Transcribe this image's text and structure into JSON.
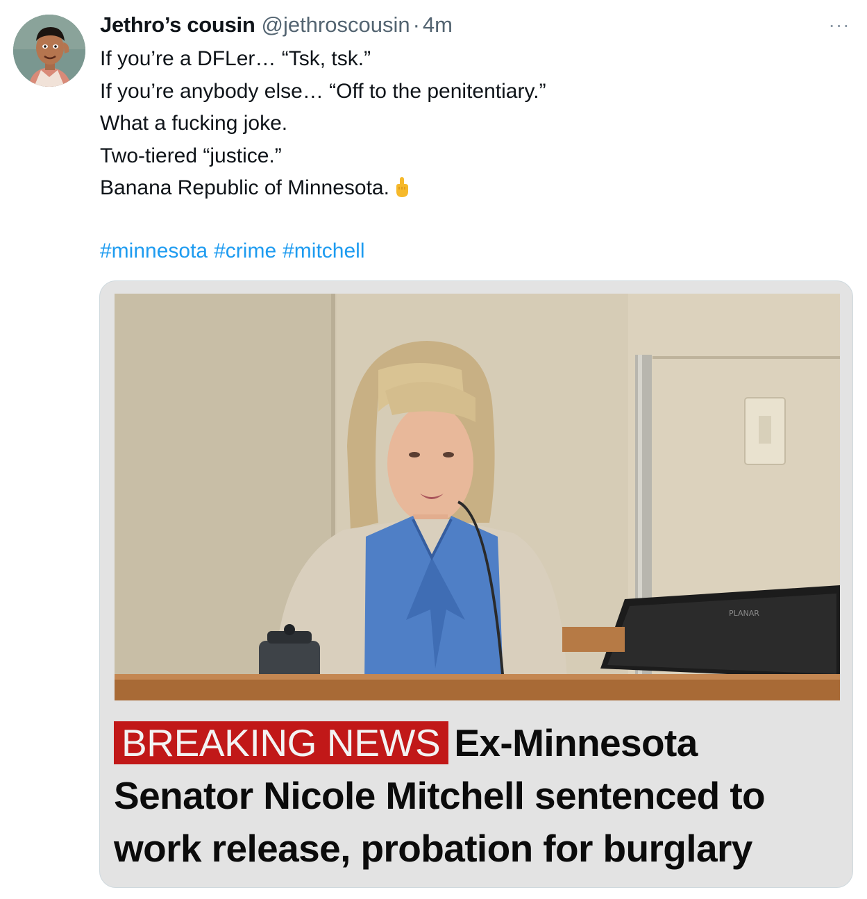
{
  "tweet": {
    "author": {
      "display_name": "Jethro’s cousin",
      "handle": "@jethroscousin",
      "separator": "·",
      "time": "4m"
    },
    "more_label": "···",
    "lines": [
      "If you’re a DFLer… “Tsk, tsk.”",
      "If you’re anybody else… “Off to the penitentiary.”",
      "What a fucking joke.",
      "Two-tiered “justice.”",
      "Banana Republic of Minnesota."
    ],
    "emoji": "middle-finger-emoji",
    "hashtags": [
      "#minnesota",
      "#crime",
      "#mitchell"
    ]
  },
  "media": {
    "monitor_brand": "PLANAR",
    "headline": {
      "badge": "BREAKING NEWS",
      "text": "Ex-Minnesota Senator Nicole Mitchell sentenced to work release, probation for burglary"
    }
  },
  "colors": {
    "link": "#1d9bf0",
    "secondary_text": "#536471",
    "breaking_badge": "#c11818"
  }
}
